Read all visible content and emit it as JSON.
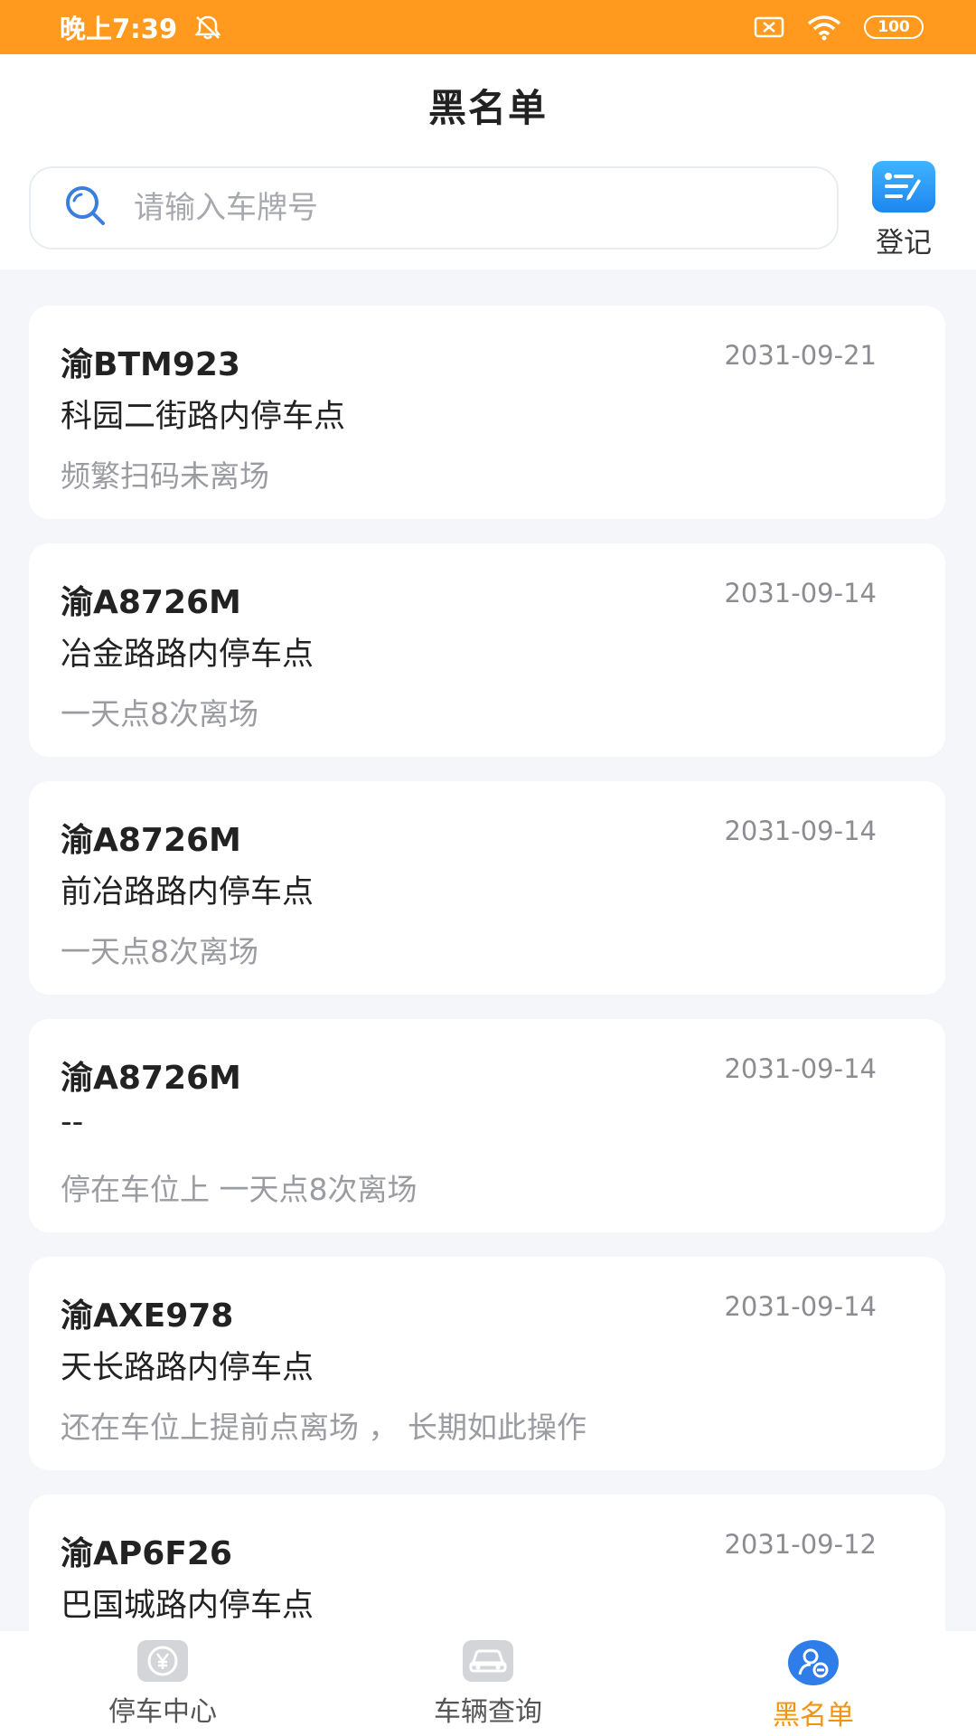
{
  "status_bar": {
    "time": "晚上7:39",
    "battery": "100",
    "bg_color": "#ff9a1e"
  },
  "header": {
    "title": "黑名单",
    "search": {
      "placeholder": "请输入车牌号",
      "value": ""
    },
    "register_button": {
      "label": "登记",
      "icon": "register-edit-icon"
    }
  },
  "records": [
    {
      "plate": "渝BTM923",
      "date": "2031-09-21",
      "location": "科园二街路内停车点",
      "reason": "频繁扫码未离场"
    },
    {
      "plate": "渝A8726M",
      "date": "2031-09-14",
      "location": "冶金路路内停车点",
      "reason": "一天点8次离场"
    },
    {
      "plate": "渝A8726M",
      "date": "2031-09-14",
      "location": "前冶路路内停车点",
      "reason": "一天点8次离场"
    },
    {
      "plate": "渝A8726M",
      "date": "2031-09-14",
      "location": "--",
      "reason": "停在车位上 一天点8次离场"
    },
    {
      "plate": "渝AXE978",
      "date": "2031-09-14",
      "location": "天长路路内停车点",
      "reason": "还在车位上提前点离场 ， 长期如此操作"
    },
    {
      "plate": "渝AP6F26",
      "date": "2031-09-12",
      "location": "巴国城路内停车点",
      "reason": ""
    }
  ],
  "tabbar": {
    "tabs": [
      {
        "label": "停车中心",
        "icon": "yuan-coin-icon",
        "active": false
      },
      {
        "label": "车辆查询",
        "icon": "car-icon",
        "active": false
      },
      {
        "label": "黑名单",
        "icon": "user-block-icon",
        "active": true
      }
    ],
    "active_color": "#f29412"
  }
}
